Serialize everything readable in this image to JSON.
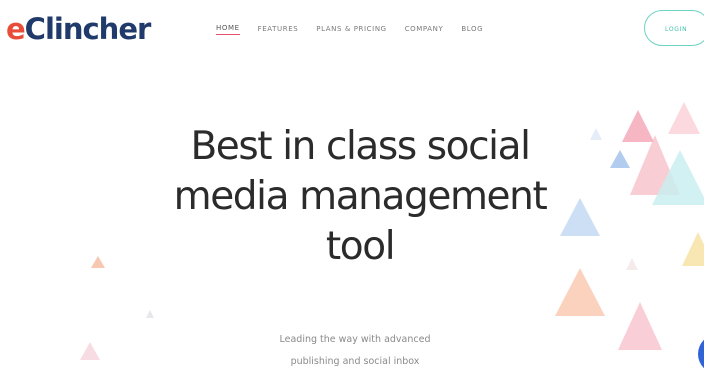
{
  "brand": {
    "logo_first": "e",
    "logo_rest": "Clincher",
    "accent_color": "#e84d3a",
    "primary_color": "#1f3a6b"
  },
  "nav": {
    "items": [
      {
        "label": "HOME",
        "active": true
      },
      {
        "label": "FEATURES",
        "active": false
      },
      {
        "label": "PLANS & PRICING",
        "active": false
      },
      {
        "label": "COMPANY",
        "active": false
      },
      {
        "label": "BLOG",
        "active": false
      }
    ],
    "login_label": "LOGIN",
    "login_color": "#6ed3c4"
  },
  "hero": {
    "title_line1": "Best in class social",
    "title_line2": "media management",
    "title_line3": "tool",
    "subtitle_line1": "Leading the way with advanced",
    "subtitle_line2": "publishing and social inbox"
  },
  "decor": {
    "triangle_colors": [
      "#f6b8c4",
      "#fbd0c0",
      "#cfe3f5",
      "#c9eef0",
      "#f9e3b8",
      "#f8c7c9",
      "#d7e8f7"
    ]
  },
  "widgets": {
    "chat_icon": "chat-bubble-icon",
    "chat_color": "#2f63d6"
  }
}
